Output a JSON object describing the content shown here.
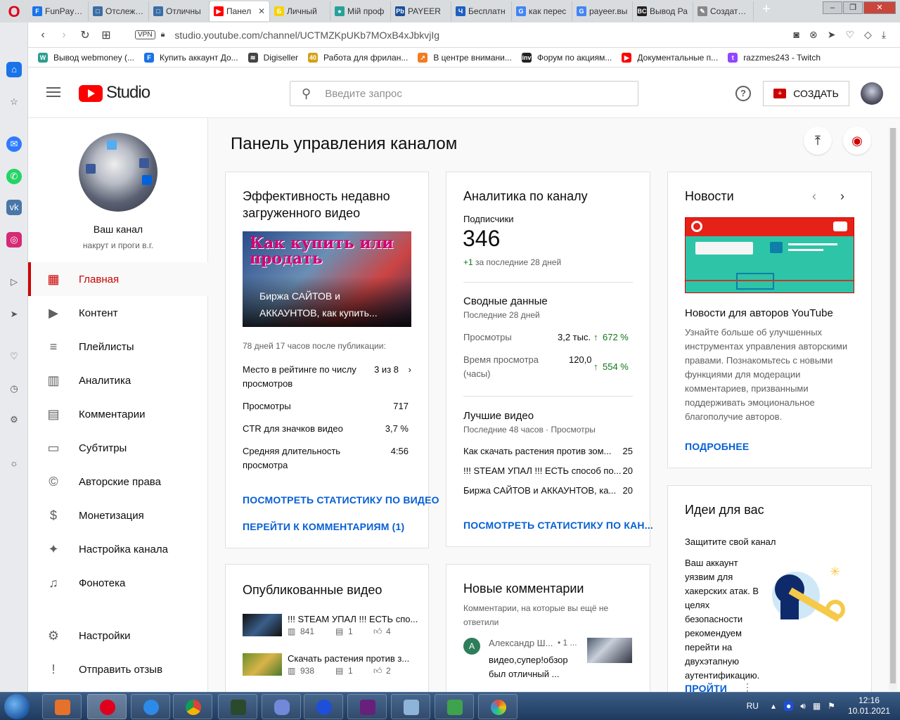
{
  "browser": {
    "tabs": [
      {
        "title": "FunPay —",
        "color": "#1a73e8",
        "letter": "F"
      },
      {
        "title": "Отслежив",
        "color": "#3a6ea5",
        "letter": "□"
      },
      {
        "title": "Отличны",
        "color": "#3a6ea5",
        "letter": "□"
      },
      {
        "title": "Панел",
        "color": "#ff0000",
        "letter": "▶",
        "active": true
      },
      {
        "title": "Личный",
        "color": "#f5d20a",
        "letter": "Б"
      },
      {
        "title": "Мій проф",
        "color": "#2aa198",
        "letter": "●"
      },
      {
        "title": "PAYEER",
        "color": "#1b4f9b",
        "letter": "Pb"
      },
      {
        "title": "Бесплатн",
        "color": "#1f5fbf",
        "letter": "Ч"
      },
      {
        "title": "как перес",
        "color": "#4285f4",
        "letter": "G"
      },
      {
        "title": "payeer.вы",
        "color": "#4285f4",
        "letter": "G"
      },
      {
        "title": "Вывод Ра",
        "color": "#222222",
        "letter": "BC"
      },
      {
        "title": "Создать а",
        "color": "#888888",
        "letter": "✎"
      }
    ],
    "new_tab": "+",
    "url": "studio.youtube.com/channel/UCTMZKpUKb7MOxB4xJbkvjIg",
    "vpn": "VPN",
    "bookmarks": [
      {
        "label": "Вывод webmoney (...",
        "color": "#2a9d8f",
        "letter": "W"
      },
      {
        "label": "Купить аккаунт До...",
        "color": "#1a73e8",
        "letter": "F"
      },
      {
        "label": "Digiseller",
        "color": "#444444",
        "letter": "≋"
      },
      {
        "label": "Работа для фрилан...",
        "color": "#d4a017",
        "letter": "40"
      },
      {
        "label": "В центре внимани...",
        "color": "#f47b20",
        "letter": "↗"
      },
      {
        "label": "Форум по акциям...",
        "color": "#222222",
        "letter": "inv"
      },
      {
        "label": "Документальные п...",
        "color": "#ff0000",
        "letter": "▶"
      },
      {
        "label": "razzmes243 - Twitch",
        "color": "#9146ff",
        "letter": "t"
      }
    ]
  },
  "header": {
    "studio": "Studio",
    "search_placeholder": "Введите запрос",
    "create": "СОЗДАТЬ"
  },
  "sidebar": {
    "channel_title": "Ваш канал",
    "channel_sub": "накрут и проги в.г.",
    "items": [
      {
        "label": "Главная",
        "icon": "dashboard-icon",
        "glyph": "▦",
        "active": true
      },
      {
        "label": "Контент",
        "icon": "content-icon",
        "glyph": "▶"
      },
      {
        "label": "Плейлисты",
        "icon": "playlist-icon",
        "glyph": "≡"
      },
      {
        "label": "Аналитика",
        "icon": "analytics-icon",
        "glyph": "▥"
      },
      {
        "label": "Комментарии",
        "icon": "comments-icon",
        "glyph": "▤"
      },
      {
        "label": "Субтитры",
        "icon": "subtitles-icon",
        "glyph": "▭"
      },
      {
        "label": "Авторские права",
        "icon": "copyright-icon",
        "glyph": "©"
      },
      {
        "label": "Монетизация",
        "icon": "dollar-icon",
        "glyph": "$"
      },
      {
        "label": "Настройка канала",
        "icon": "magic-wand-icon",
        "glyph": "✦"
      },
      {
        "label": "Фонотека",
        "icon": "audio-library-icon",
        "glyph": "♫"
      }
    ],
    "bottom_items": [
      {
        "label": "Настройки",
        "icon": "settings-gear-icon",
        "glyph": "⚙"
      },
      {
        "label": "Отправить отзыв",
        "icon": "feedback-icon",
        "glyph": "!"
      }
    ]
  },
  "main": {
    "title": "Панель управления каналом",
    "latest_video": {
      "title": "Эффективность недавно загруженного видео",
      "thumb_title": "Биржа САЙТОВ и АККАУНТОВ, как купить...",
      "thumb_overlay": "Как купить или продать",
      "since": "78 дней 17 часов после публикации:",
      "rank_label": "Место в рейтинге по числу просмотров",
      "rank_value": "3 из 8",
      "stats": [
        {
          "label": "Просмотры",
          "value": "717"
        },
        {
          "label": "CTR для значков видео",
          "value": "3,7 %"
        },
        {
          "label": "Средняя длительность просмотра",
          "value": "4:56"
        }
      ],
      "link1": "ПОСМОТРЕТЬ СТАТИСТИКУ ПО ВИДЕО",
      "link2": "ПЕРЕЙТИ К КОММЕНТАРИЯМ (1)"
    },
    "analytics": {
      "title": "Аналитика по каналу",
      "subs_label": "Подписчики",
      "subs_value": "346",
      "subs_delta": "+1",
      "subs_delta_text": "за последние 28 дней",
      "summary_title": "Сводные данные",
      "summary_sub": "Последние 28 дней",
      "views_label": "Просмотры",
      "views_value": "3,2 тыс.",
      "views_delta": "672 %",
      "watch_label": "Время просмотра (часы)",
      "watch_value": "120,0",
      "watch_delta": "554 %",
      "top_title": "Лучшие видео",
      "top_sub": "Последние 48 часов · Просмотры",
      "top_videos": [
        {
          "title": "Как скачать растения против зом...",
          "views": "25"
        },
        {
          "title": "!!! STEAM УПАЛ !!! ЕСТЬ способ по...",
          "views": "20"
        },
        {
          "title": "Биржа САЙТОВ и АККАУНТОВ, ка...",
          "views": "20"
        }
      ],
      "link": "ПОСМОТРЕТЬ СТАТИСТИКУ ПО КАН..."
    },
    "news": {
      "title": "Новости",
      "item_title": "Новости для авторов YouTube",
      "item_text": "Узнайте больше об улучшенных инструментах управления авторскими правами. Познакомьтесь с новыми функциями для модерации комментариев, призванными поддерживать эмоциональное благополучие авторов.",
      "link": "ПОДРОБНЕЕ"
    },
    "ideas": {
      "title": "Идеи для вас",
      "sub": "Защитите свой канал",
      "text": "Ваш аккаунт уязвим для хакерских атак. В целях безопасности рекомендуем перейти на двухэтапную аутентификацию.",
      "link": "ПРОЙТИ"
    },
    "published": {
      "title": "Опубликованные видео",
      "videos": [
        {
          "title": "!!! STEAM УПАЛ !!! ЕСТЬ спо...",
          "views": "841",
          "comments": "1",
          "likes": "4"
        },
        {
          "title": "Скачать растения против з...",
          "views": "938",
          "comments": "1",
          "likes": "2"
        }
      ]
    },
    "comments": {
      "title": "Новые комментарии",
      "sub": "Комментарии, на которые вы ещё не ответили",
      "author_initial": "А",
      "author": "Александр Ш...",
      "time": "• 1 ...",
      "text": "видео,супер!обзор был отличный ..."
    }
  },
  "taskbar": {
    "lang": "RU",
    "time": "12:16",
    "date": "10.01.2021"
  }
}
